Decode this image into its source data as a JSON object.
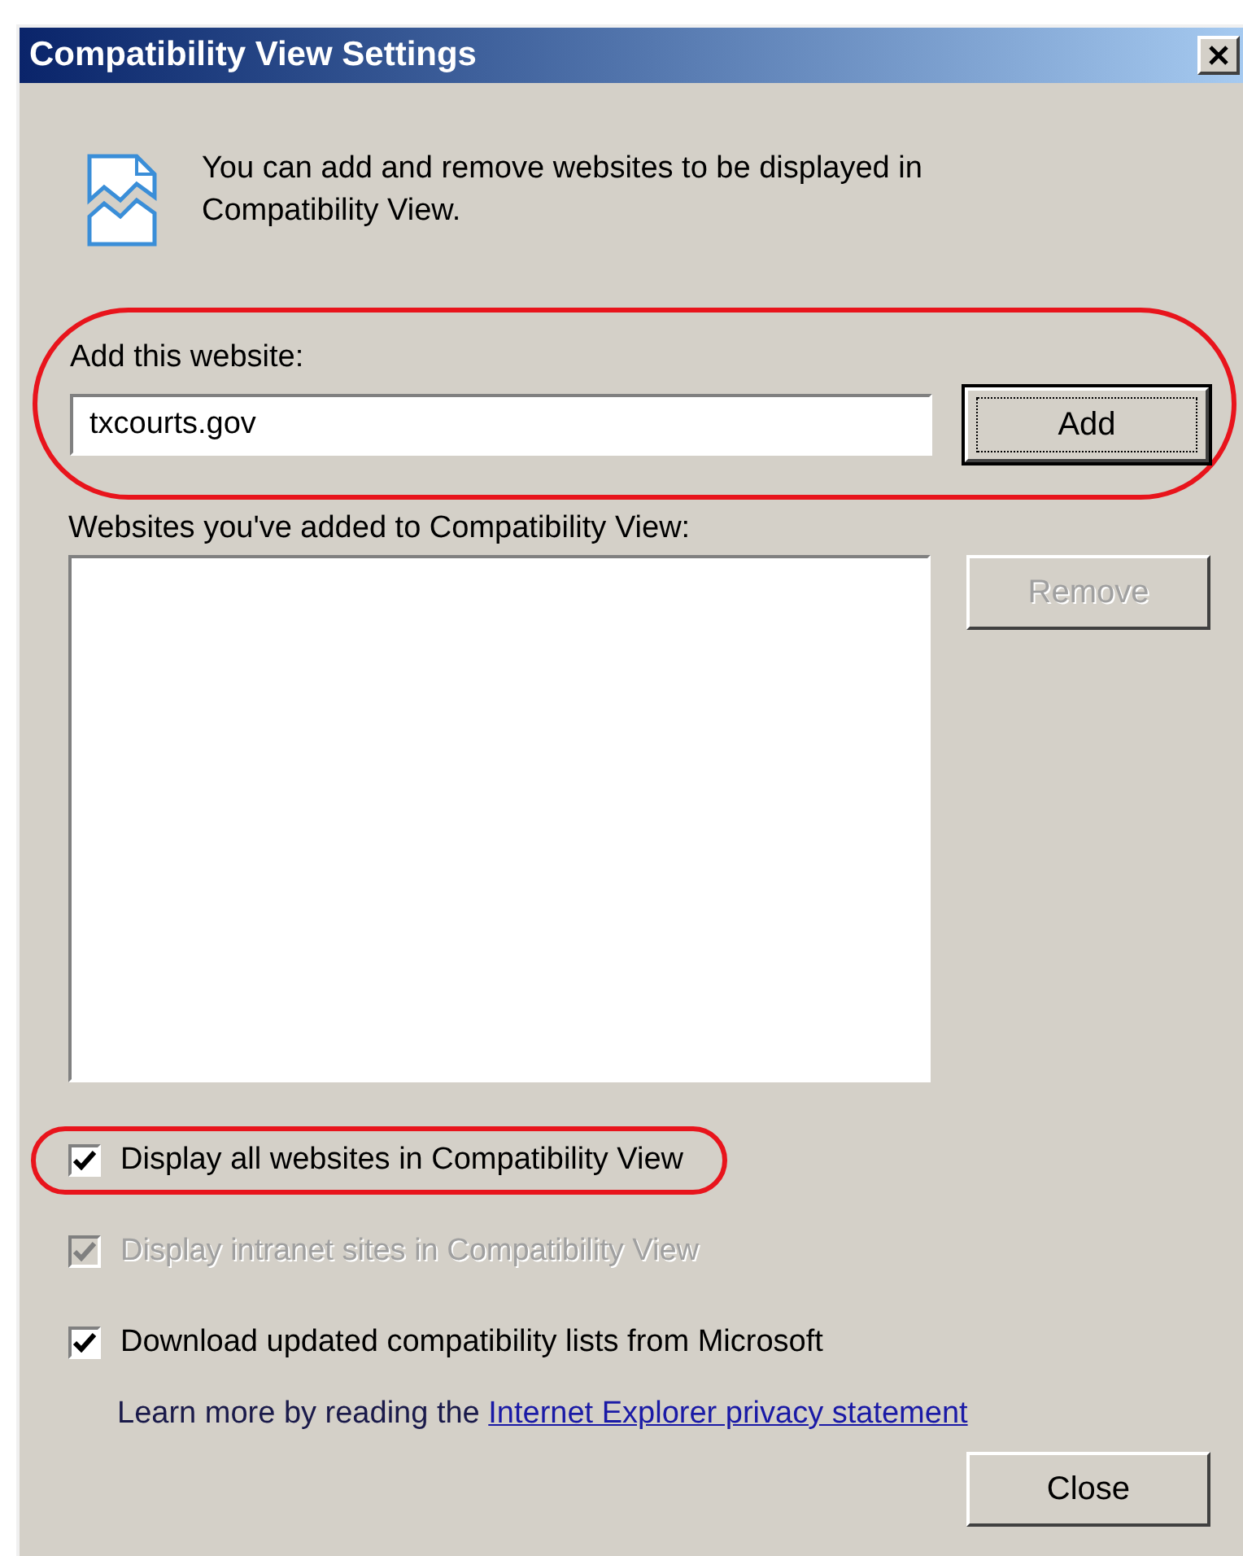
{
  "window": {
    "title": "Compatibility View Settings"
  },
  "description": "You can add and remove websites to be displayed in Compatibility View.",
  "add_website": {
    "label": "Add this website:",
    "value": "txcourts.gov",
    "button": "Add",
    "highlighted": true
  },
  "websites_list": {
    "label": "Websites you've added to Compatibility View:",
    "remove_button": {
      "label": "Remove",
      "disabled": true
    }
  },
  "options": [
    {
      "label": "Display all websites in Compatibility View",
      "checked": true,
      "disabled": false,
      "highlighted": true
    },
    {
      "label": "Display intranet sites in Compatibility View",
      "checked": true,
      "disabled": true,
      "highlighted": false
    },
    {
      "label": "Download updated compatibility lists from Microsoft",
      "checked": true,
      "disabled": false,
      "highlighted": false
    }
  ],
  "learn_more": {
    "text": "Learn more by reading the",
    "link": "Internet Explorer privacy statement"
  },
  "buttons": [
    "Close"
  ]
}
